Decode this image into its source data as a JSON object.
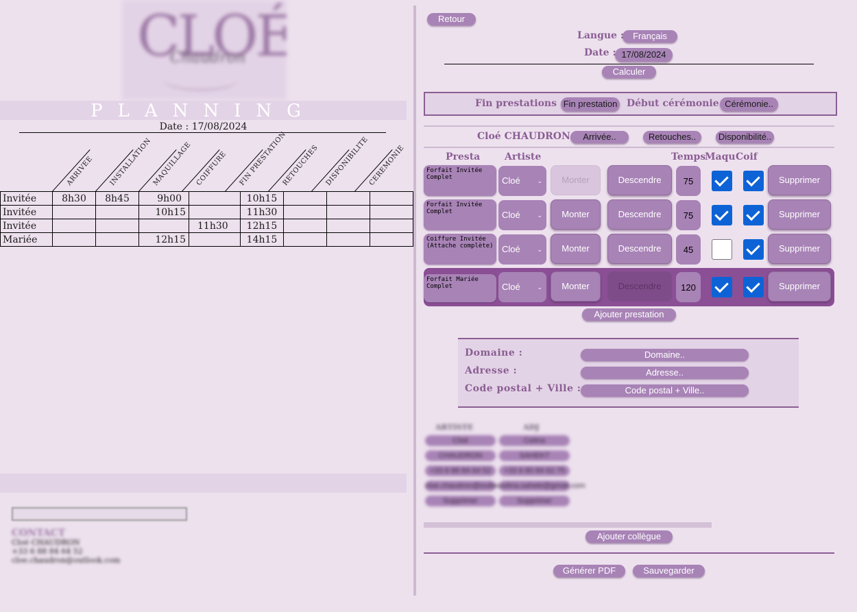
{
  "left": {
    "logo": {
      "brand": "CLOÉ",
      "sub": "Chaudron"
    },
    "planning_title": "PLANNING",
    "date_line": "Date : 17/08/2024",
    "columns": [
      "ARRIVEE",
      "INSTALLATION",
      "MAQUILLAGE",
      "COIFFURE",
      "FIN PRESTATION",
      "RETOUCHES",
      "DISPONIBILITE",
      "CEREMONIE"
    ],
    "rows": [
      {
        "label": "Invitée",
        "cells": [
          "8h30",
          "8h45",
          "9h00",
          "",
          "10h15",
          "",
          "",
          ""
        ]
      },
      {
        "label": "Invitée",
        "cells": [
          "",
          "",
          "10h15",
          "",
          "11h30",
          "",
          "",
          ""
        ]
      },
      {
        "label": "Invitée",
        "cells": [
          "",
          "",
          "",
          "11h30",
          "12h15",
          "",
          "",
          ""
        ]
      },
      {
        "label": "Mariée",
        "cells": [
          "",
          "",
          "12h15",
          "",
          "14h15",
          "",
          "",
          ""
        ]
      }
    ],
    "contact": {
      "heading": "CONTACT",
      "name": "Cloé CHAUDRON",
      "phone": "+33 6 88 84 64 52",
      "email": "cloe.chaudron@outlook.com"
    }
  },
  "right": {
    "back_label": "Retour",
    "langue_label": "Langue :",
    "langue_value": "Français",
    "date_label": "Date :",
    "date_value": "17/08/2024",
    "calculer_label": "Calculer",
    "fin_label": "Fin prestations :",
    "fin_value": "Fin prestation",
    "debut_label": "Début cérémonie :",
    "debut_value": "Cérémonie..",
    "artist_name": "Cloé CHAUDRON",
    "arrivee_btn": "Arrivée..",
    "retouches_btn": "Retouches..",
    "dispo_btn": "Disponibilité..",
    "headers": {
      "presta": "Presta",
      "artiste": "Artiste",
      "temps": "Temps",
      "maqu": "Maqu",
      "coif": "Coif"
    },
    "monter_label": "Monter",
    "descendre_label": "Descendre",
    "supprimer_label": "Supprimer",
    "prestations": [
      {
        "name": "Forfait Invitée Complet",
        "artist": "Cloé",
        "temps": "75",
        "maqu": true,
        "coif": true
      },
      {
        "name": "Forfait Invitée Complet",
        "artist": "Cloé",
        "temps": "75",
        "maqu": true,
        "coif": true
      },
      {
        "name": "Coiffure Invitée (Attache complète)",
        "artist": "Cloé",
        "temps": "45",
        "maqu": false,
        "coif": true
      },
      {
        "name": "Forfait Mariée Complet",
        "artist": "Cloé",
        "temps": "120",
        "maqu": true,
        "coif": true
      }
    ],
    "ajouter_prestation": "Ajouter prestation",
    "domaine_label": "Domaine :",
    "domaine_value": "Domaine..",
    "adresse_label": "Adresse :",
    "adresse_value": "Adresse..",
    "cp_label": "Code postal + Ville :",
    "cp_value": "Code postal + Ville..",
    "colleagues": {
      "headers": [
        "ARTISTE",
        "ADJ"
      ],
      "col1": [
        "Cloé",
        "CHAUDRON",
        "+33 6 88 84 64 52",
        "cloe.chaudron@outlook.com",
        "Supprimer"
      ],
      "col2": [
        "Celina",
        "SAHEKT",
        "+33 6 80 84 62 75",
        "celina.sahekt@gmail.com",
        "Supprimer"
      ]
    },
    "ajouter_collegue": "Ajouter collègue",
    "pdf_label": "Générer PDF",
    "save_label": "Sauvegarder"
  },
  "colors": {
    "accent": "#a883b6",
    "dark_accent": "#8b4f95",
    "background": "#ede1ee",
    "check": "#0d63d6"
  }
}
